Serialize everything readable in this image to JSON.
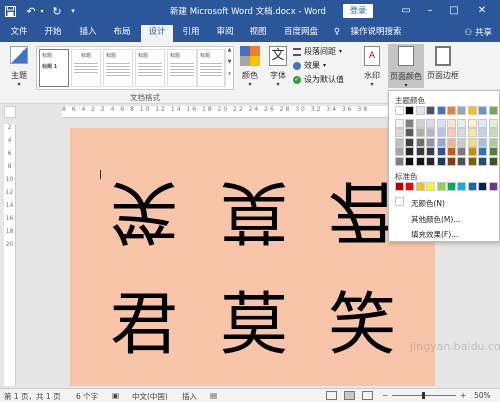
{
  "titlebar": {
    "title": "新建 Microsoft Word 文档.docx  -  Word",
    "login_label": "登录",
    "save_icon": "save-icon",
    "undo_icon": "undo-icon",
    "redo_icon": "redo-icon",
    "customize_icon": "customize-quick-access-icon",
    "ribbon_options_icon": "ribbon-display-options-icon",
    "minimize_icon": "minimize-icon",
    "maximize_icon": "maximize-icon",
    "close_icon": "close-icon"
  },
  "tabs": [
    {
      "label": "文件"
    },
    {
      "label": "开始"
    },
    {
      "label": "插入"
    },
    {
      "label": "布局"
    },
    {
      "label": "设计",
      "active": true
    },
    {
      "label": "引用"
    },
    {
      "label": "审阅"
    },
    {
      "label": "视图"
    },
    {
      "label": "百度网盘"
    },
    {
      "label": "操作说明搜索"
    }
  ],
  "share_label": "共享",
  "ribbon": {
    "theme_label": "主题",
    "style_thumbs": [
      "标题",
      "标题",
      "标题",
      "标题",
      "标题",
      "标题"
    ],
    "first_thumb_heading": "标题 1",
    "doc_format_label": "文档格式",
    "colors_label": "颜色",
    "fonts_label": "字体",
    "paragraph_spacing_label": "段落间距",
    "effects_label": "效果",
    "set_default_label": "设为默认值",
    "watermark_label": "水印",
    "page_color_label": "页面颜色",
    "page_borders_label": "页面边框"
  },
  "page": {
    "row_top_flipped": [
      "笑",
      "莫",
      "君"
    ],
    "row_bottom": [
      "君",
      "莫",
      "笑"
    ],
    "background": "#f8c5ab"
  },
  "color_menu": {
    "theme_colors_label": "主题颜色",
    "standard_colors_label": "标准色",
    "no_color_label": "无颜色(N)",
    "more_colors_label": "其他颜色(M)...",
    "fill_effects_label": "填充效果(F)...",
    "theme_rows": [
      [
        "#ffffff",
        "#000000",
        "#e7e6e6",
        "#44546a",
        "#4472c4",
        "#ed7d31",
        "#a5a5a5",
        "#ffc000",
        "#5b9bd5",
        "#70ad47"
      ],
      [
        "#f2f2f2",
        "#7f7f7f",
        "#d0cece",
        "#d6dce4",
        "#d9e2f3",
        "#fbe5d5",
        "#ededed",
        "#fff2cc",
        "#deebf6",
        "#e2efd9"
      ],
      [
        "#d8d8d8",
        "#595959",
        "#aeabab",
        "#adb9ca",
        "#b4c6e7",
        "#f7cbac",
        "#dbdbdb",
        "#fee599",
        "#bdd7ee",
        "#c5e0b3"
      ],
      [
        "#bfbfbf",
        "#3f3f3f",
        "#757070",
        "#8496b0",
        "#8eaadb",
        "#f4b183",
        "#c9c9c9",
        "#ffd965",
        "#9cc3e5",
        "#a8d08d"
      ],
      [
        "#a5a5a5",
        "#262626",
        "#3a3838",
        "#323f4f",
        "#2f5496",
        "#c55a11",
        "#7b7b7b",
        "#bf9000",
        "#2e75b5",
        "#538135"
      ],
      [
        "#7f7f7f",
        "#0c0c0c",
        "#171616",
        "#222a35",
        "#1f3864",
        "#833c0b",
        "#525252",
        "#7f6000",
        "#1e4e79",
        "#375623"
      ]
    ],
    "standard_colors": [
      "#c00000",
      "#ff0000",
      "#ffc000",
      "#ffff00",
      "#92d050",
      "#00b050",
      "#00b0f0",
      "#0070c0",
      "#002060",
      "#7030a0"
    ]
  },
  "statusbar": {
    "page_info": "第 1 页，共 1 页",
    "word_count": "6 个字",
    "language": "中文(中国)",
    "insert_mode": "插入",
    "zoom": "50%",
    "zoom_out": "−",
    "zoom_in": "+"
  },
  "watermark_text": "jingyan.baidu.com",
  "ruler_marks": "8 6 4 2  2 4 6 8 10 12 14 16 18 20 22 24 26 28 30 32 34 36 38",
  "vruler_marks": [
    "2",
    "4",
    "6",
    "8",
    "10",
    "12",
    "14",
    "16",
    "18",
    "20"
  ]
}
